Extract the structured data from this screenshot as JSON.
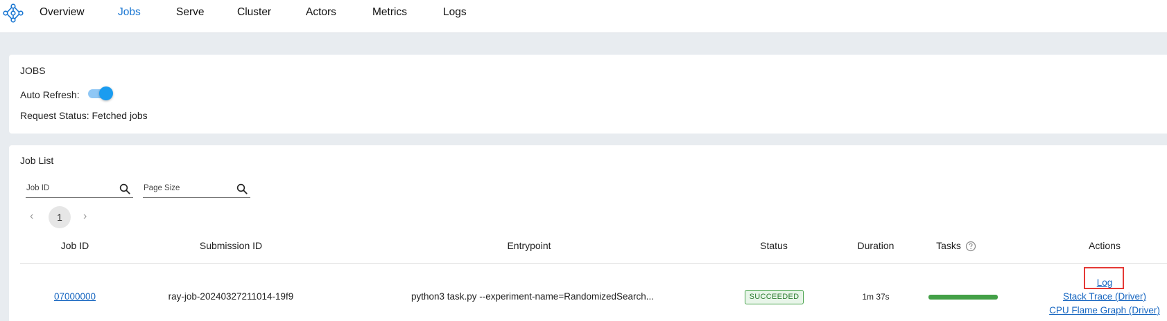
{
  "nav": {
    "items": [
      "Overview",
      "Jobs",
      "Serve",
      "Cluster",
      "Actors",
      "Metrics",
      "Logs"
    ],
    "active": "Jobs"
  },
  "jobs_card": {
    "title": "JOBS",
    "auto_refresh_label": "Auto Refresh:",
    "auto_refresh_on": true,
    "request_status": "Request Status: Fetched jobs"
  },
  "job_list": {
    "title": "Job List",
    "search_job_id_placeholder": "Job ID",
    "search_page_size_placeholder": "Page Size",
    "pager": {
      "prev": "‹",
      "page": "1",
      "next": "›"
    },
    "columns": [
      "Job ID",
      "Submission ID",
      "Entrypoint",
      "Status",
      "Duration",
      "Tasks",
      "Actions"
    ],
    "rows": [
      {
        "job_id": "07000000",
        "submission_id": "ray-job-20240327211014-19f9",
        "entrypoint": "python3 task.py --experiment-name=RandomizedSearch...",
        "status": "SUCCEEDED",
        "duration": "1m 37s",
        "tasks_progress": 1.0,
        "actions": [
          "Log",
          "Stack Trace (Driver)",
          "CPU Flame Graph (Driver)"
        ]
      }
    ]
  },
  "colors": {
    "accent": "#1976d2",
    "success": "#43a047",
    "highlight": "#e53935"
  },
  "icons": {
    "logo": "ray-logo-icon",
    "search": "search-icon",
    "help": "help-circle-icon"
  }
}
